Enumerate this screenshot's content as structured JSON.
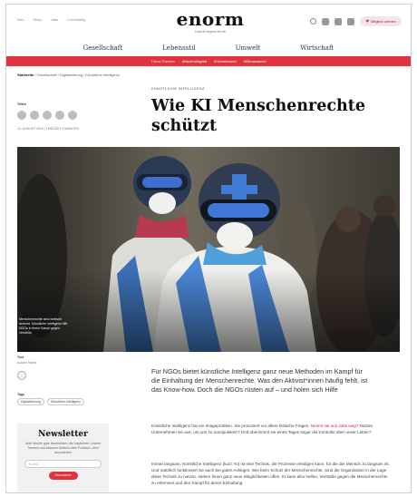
{
  "topbar": {
    "links": [
      "Neu",
      "Shop",
      "Jobs",
      "Community"
    ],
    "logo_word": "enorm",
    "logo_sub": "Zukunft beginnt bei dir",
    "member_label": "Mitglied werden",
    "icons": [
      "search-icon",
      "facebook-icon",
      "instagram-icon",
      "linkedin-icon"
    ]
  },
  "nav": {
    "categories": [
      "Gesellschaft",
      "Lebensstil",
      "Umwelt",
      "Wirtschaft"
    ],
    "red_items": [
      "Trend-Themen",
      "#Nachhaltigkeit",
      "#Gemeinwohl",
      "#Klimawandel"
    ]
  },
  "breadcrumb": {
    "home": "Startseite",
    "trail": "/ Gesellschaft / Digitalisierung / Künstliche Intelligenz"
  },
  "meta": {
    "share_label": "Teilen",
    "share_icons": [
      "facebook-icon",
      "twitter-icon",
      "linkedin-icon",
      "pinterest-icon",
      "mail-icon"
    ],
    "date": "12. AUGUST 2019 | LESEZEIT 4 MINUTEN"
  },
  "article": {
    "kicker": "KÜNSTLICHE INTELLIGENZ",
    "title": "Wie KI Menschenrechte schützt",
    "caption": "Menschenrechte sind weltweit bedroht. Künstliche Intelligenz hilft NGOs in ihrem Kampf gegen Verstöße",
    "lead": "Für NGOs bietet künstliche Intelligenz ganz neue Methoden im Kampf für die Einhaltung der Menschenrechte. Was den Aktivist*innen häufig fehlt, ist das Know-how. Doch die NGOs rüsten auf – und holen sich Hilfe",
    "p1_start": "Künstliche Intelligenz hat ein Imageproblem. Sie provoziert vor allem kritische Fragen: ",
    "p1_link": "Nimmt sie uns Jobs weg?",
    "p1_end": " Nutzen Unternehmen sie aus, um uns zu manipulieren? Und übernimmt sie eines Tages sogar die Kontrolle über unser Leben?",
    "p2": "Immer langsam. Künstliche Intelligenz (kurz: KI) ist eine Technik, die Prozesse erledigen kann, für die der Mensch zu langsam ist. Und natürlich funktioniert sie auch bei guten Anliegen. Wie beim Schutz der Menschenrechte. Sind die Organisation in der Lage diese Technik zu nutzen, stehen ihnen ganz neue Möglichkeiten offen. KI kann also helfen, Verstöße gegen die Menschenrechte zu erkennen und den Kampf für deren Einhaltung"
  },
  "sidebar": {
    "credit_label": "Text",
    "credit_name": "Autorin Name",
    "tags_label": "Tags",
    "tags": [
      "Digitalisierung",
      "Künstliche Intelligenz"
    ]
  },
  "newsletter": {
    "title": "Newsletter",
    "text": "Jede Woche gute Nachrichten, die inspirieren: Unsere Themen und Aktionen direkt in dein Postfach. Jetzt abonnieren!",
    "placeholder": "E-Mail",
    "button": "Abonnieren"
  },
  "colors": {
    "accent": "#e0333f",
    "link": "#c8213a"
  }
}
